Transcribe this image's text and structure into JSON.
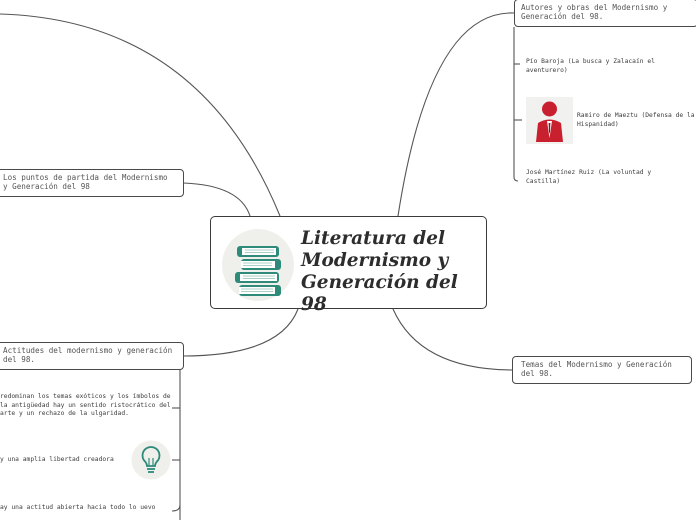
{
  "central": {
    "title": "Literatura del Modernismo y Generación del 98",
    "icon": "books-icon"
  },
  "topics": {
    "autores": {
      "label": "Autores y obras del Modernismo y Generación del 98.",
      "items": [
        "Pío Baroja  (La busca y Zalacaín el aventurero)",
        "Ramiro de Maeztu (Defensa de la Hispanidad)",
        "José Martínez Ruiz (La voluntad y Castilla)"
      ],
      "avatar_icon": "person-avatar-icon"
    },
    "puntos": {
      "label": "Los puntos de partida del Modernismo y Generación del 98"
    },
    "temas": {
      "label": "Temas del Modernismo y Generación del 98."
    },
    "actitudes": {
      "label": "Actitudes del modernismo y generación del 98.",
      "items": [
        "redominan los temas exóticos y los ímbolos de la antigüedad hay un sentido ristocrático del arte y un rechazo de la ulgaridad.",
        "y una amplia libertad creadora",
        "ay una actitud abierta hacia todo lo uevo"
      ],
      "bulb_icon": "lightbulb-icon"
    }
  },
  "colors": {
    "line": "#555555",
    "accent_teal": "#2e8b7a",
    "avatar_red": "#c8202e"
  }
}
